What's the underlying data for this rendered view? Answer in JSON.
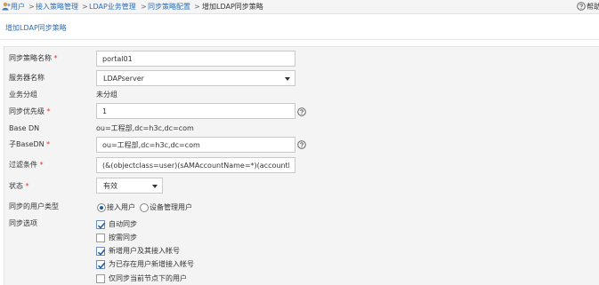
{
  "breadcrumb": {
    "items": [
      "用户",
      "接入策略管理",
      "LDAP业务管理",
      "同步策略配置",
      "增加LDAP同步策略"
    ],
    "separator": ">"
  },
  "help": {
    "label": "帮助"
  },
  "page": {
    "title": "增加LDAP同步策略"
  },
  "form": {
    "required_mark": "*",
    "policy_name": {
      "label": "同步策略名称",
      "value": "portal01"
    },
    "server_name": {
      "label": "服务器名称",
      "selected": "LDAPserver"
    },
    "service_group": {
      "label": "业务分组",
      "value": "未分组"
    },
    "priority": {
      "label": "同步优先级",
      "value": "1"
    },
    "base_dn": {
      "label": "Base DN",
      "value": "ou=工程部,dc=h3c,dc=com"
    },
    "sub_base_dn": {
      "label": "子BaseDN",
      "value": "ou=工程部,dc=h3c,dc=com"
    },
    "filter": {
      "label": "过滤条件",
      "value": "(&(objectclass=user)(sAMAccountName=*)(accountExp"
    },
    "status": {
      "label": "状态",
      "selected": "有效"
    },
    "user_type": {
      "label": "同步的用户类型",
      "options": [
        "接入用户",
        "设备管理用户"
      ],
      "selected_index": 0
    },
    "sync_options": {
      "label": "同步选项",
      "items": [
        {
          "label": "自动同步",
          "checked": true
        },
        {
          "label": "按需同步",
          "checked": false
        },
        {
          "label": "新增用户及其接入帐号",
          "checked": true
        },
        {
          "label": "为已存在用户新增接入帐号",
          "checked": true
        },
        {
          "label": "仅同步当前节点下的用户",
          "checked": false
        }
      ]
    }
  }
}
